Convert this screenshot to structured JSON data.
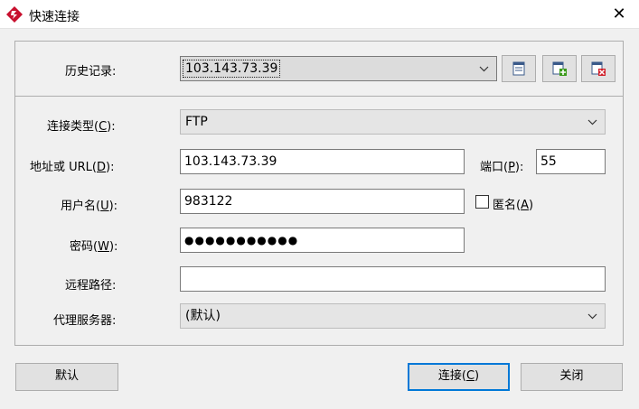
{
  "window": {
    "title": "快速连接",
    "close_glyph": "✕"
  },
  "history": {
    "label": "历史记录:",
    "value": "103.143.73.39",
    "chevron": "⌵",
    "buttons": [
      "edit-list-icon",
      "add-entry-icon",
      "delete-entry-icon"
    ]
  },
  "form": {
    "conn_type": {
      "label_pre": "连接类型(",
      "label_key": "C",
      "label_post": "):",
      "value": "FTP"
    },
    "address": {
      "label_pre": "地址或 URL(",
      "label_key": "D",
      "label_post": "):",
      "value": "103.143.73.39"
    },
    "port": {
      "label_pre": "端口(",
      "label_key": "P",
      "label_post": "):",
      "value": "55"
    },
    "username": {
      "label_pre": "用户名(",
      "label_key": "U",
      "label_post": "):",
      "value": "983122"
    },
    "anonymous": {
      "label_pre": "匿名(",
      "label_key": "A",
      "label_post": ")",
      "checked": false
    },
    "password": {
      "label_pre": "密码(",
      "label_key": "W",
      "label_post": "):",
      "value": "●●●●●●●●●●●"
    },
    "remote_path": {
      "label": "远程路径:",
      "value": ""
    },
    "proxy": {
      "label": "代理服务器:",
      "value": "(默认)"
    }
  },
  "footer": {
    "default_label": "默认",
    "connect_pre": "连接(",
    "connect_key": "C",
    "connect_post": ")",
    "close_label": "关闭"
  },
  "colors": {
    "accent": "#0078d7",
    "icon_red": "#c8102e",
    "icon_green": "#3a9a1a"
  }
}
